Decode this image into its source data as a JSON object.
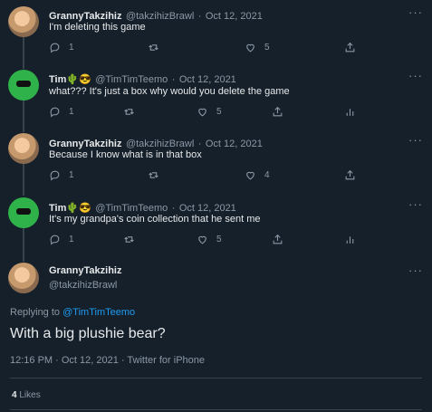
{
  "tweets": [
    {
      "name": "GrannyTakzihiz",
      "handle": "@takzihizBrawl",
      "sep": "·",
      "date": "Oct 12, 2021",
      "text": "I'm deleting this game",
      "replies": "1",
      "likes": "5"
    },
    {
      "name": "Tim🌵😎",
      "handle": "@TimTimTeemo",
      "sep": "·",
      "date": "Oct 12, 2021",
      "text": "what??? It's just a box why would you delete the game",
      "replies": "1",
      "likes": "5"
    },
    {
      "name": "GrannyTakzihiz",
      "handle": "@takzihizBrawl",
      "sep": "·",
      "date": "Oct 12, 2021",
      "text": "Because I know what is in that box",
      "replies": "1",
      "likes": "4"
    },
    {
      "name": "Tim🌵😎",
      "handle": "@TimTimTeemo",
      "sep": "·",
      "date": "Oct 12, 2021",
      "text": "It's my grandpa's coin collection that he sent me",
      "replies": "1",
      "likes": "5"
    }
  ],
  "main": {
    "name": "GrannyTakzihiz",
    "handle": "@takzihizBrawl",
    "replying_prefix": "Replying to",
    "replying_to": "@TimTimTeemo",
    "text": "With a big plushie bear?",
    "timestamp": "12:16 PM · Oct 12, 2021 · Twitter for iPhone",
    "likes_count": "4",
    "likes_label": "Likes"
  },
  "more_glyph": "···",
  "colors": {
    "background": "#15202b",
    "accent": "#1d9bf0",
    "muted": "#8b98a5",
    "divider": "#38444d"
  }
}
